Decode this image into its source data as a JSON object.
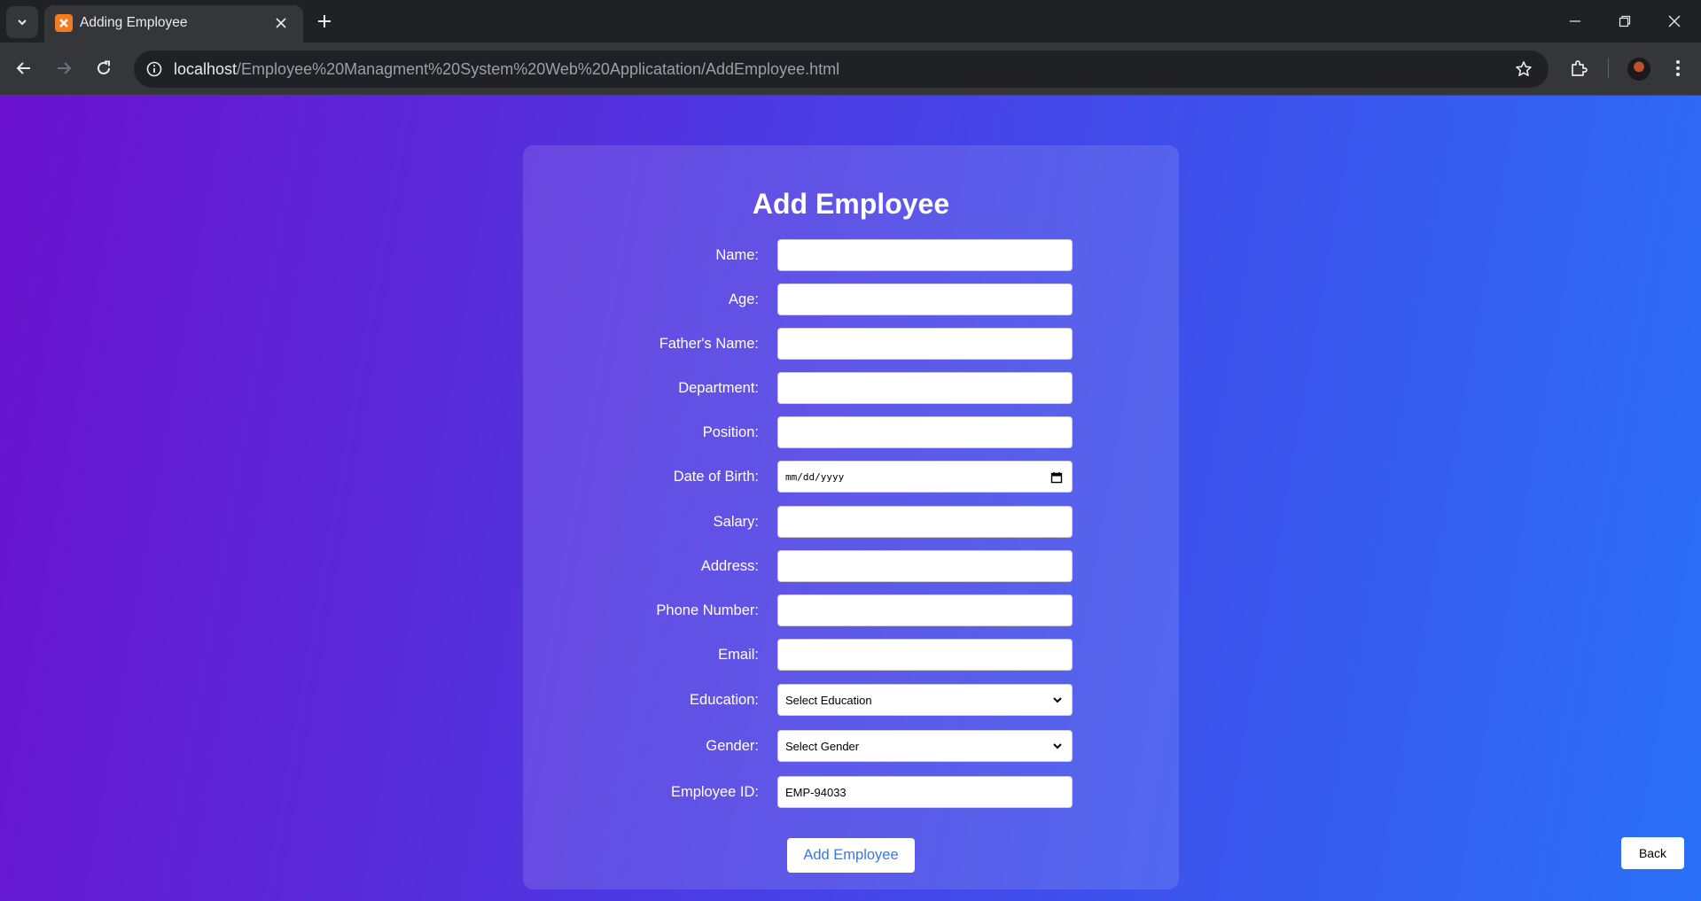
{
  "browser": {
    "tab": {
      "title": "Adding Employee",
      "favicon": "xampp-icon"
    },
    "address": {
      "host": "localhost",
      "path": "/Employee%20Managment%20System%20Web%20Applicatation/AddEmployee.html"
    }
  },
  "form": {
    "title": "Add Employee",
    "fields": [
      {
        "label": "Name:",
        "value": ""
      },
      {
        "label": "Age:",
        "value": ""
      },
      {
        "label": "Father's Name:",
        "value": ""
      },
      {
        "label": "Department:",
        "value": ""
      },
      {
        "label": "Position:",
        "value": ""
      },
      {
        "label": "Date of Birth:",
        "value": "mm/dd/yyyy"
      },
      {
        "label": "Salary:",
        "value": ""
      },
      {
        "label": "Address:",
        "value": ""
      },
      {
        "label": "Phone Number:",
        "value": ""
      },
      {
        "label": "Email:",
        "value": ""
      },
      {
        "label": "Education:",
        "value": "Select Education"
      },
      {
        "label": "Gender:",
        "value": "Select Gender"
      },
      {
        "label": "Employee ID:",
        "value": "EMP-94033"
      }
    ],
    "submit_label": "Add Employee"
  },
  "back_label": "Back",
  "colors": {
    "gradient_start": "#6a12cd",
    "gradient_mid": "#4b3ce3",
    "gradient_end": "#2a6ff7",
    "button_text": "#3a77e6"
  }
}
